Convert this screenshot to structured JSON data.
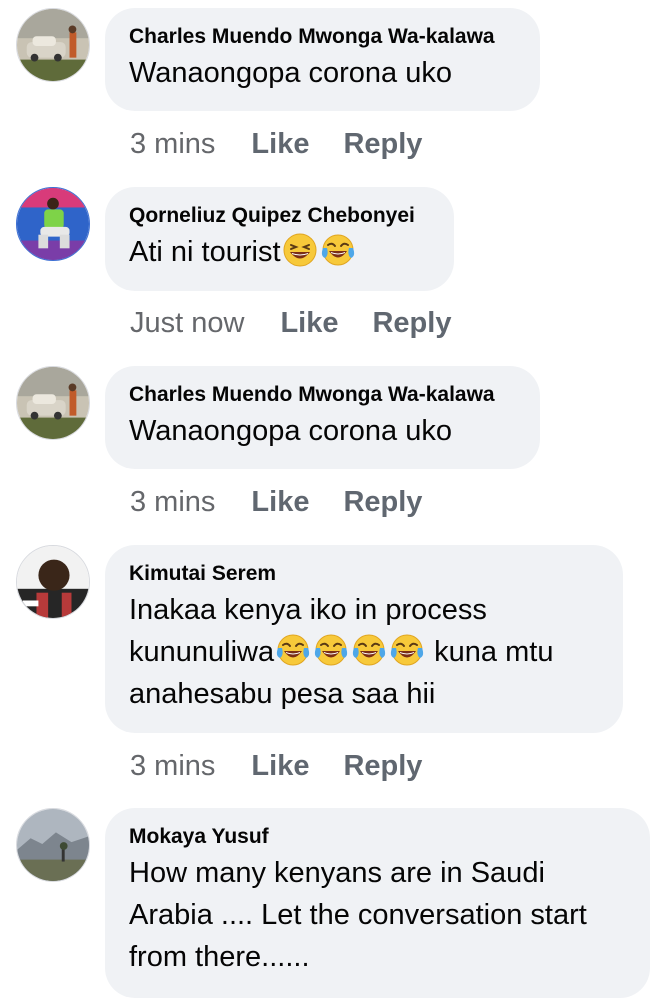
{
  "comments": [
    {
      "author": "Charles Muendo Mwonga Wa-kalawa",
      "text_lines": [
        "Wanaongopa corona uko"
      ],
      "time": "3 mins",
      "like": "Like",
      "reply": "Reply"
    },
    {
      "author": "Qorneliuz Quipez Chebonyei",
      "text_lines": [
        "Ati ni tourist"
      ],
      "time": "Just now",
      "like": "Like",
      "reply": "Reply"
    },
    {
      "author": "Charles Muendo Mwonga Wa-kalawa",
      "text_lines": [
        "Wanaongopa corona uko"
      ],
      "time": "3 mins",
      "like": "Like",
      "reply": "Reply"
    },
    {
      "author": "Kimutai Serem",
      "text_lines": [
        "Inakaa kenya iko in process",
        "kununuliwa",
        "kuna mtu",
        "anahesabu pesa saa hii"
      ],
      "time": "3 mins",
      "like": "Like",
      "reply": "Reply"
    },
    {
      "author": "Mokaya Yusuf",
      "text_lines": [
        "How many kenyans are in Saudi",
        "Arabia .... Let the conversation start",
        "from there......"
      ]
    }
  ],
  "emoji": {
    "grinning": "grinning-squinting-face-icon",
    "tears_of_joy": "face-with-tears-of-joy-icon"
  },
  "colors": {
    "bubble_bg": "#f0f2f5",
    "text": "#050505",
    "meta": "#65676b"
  }
}
